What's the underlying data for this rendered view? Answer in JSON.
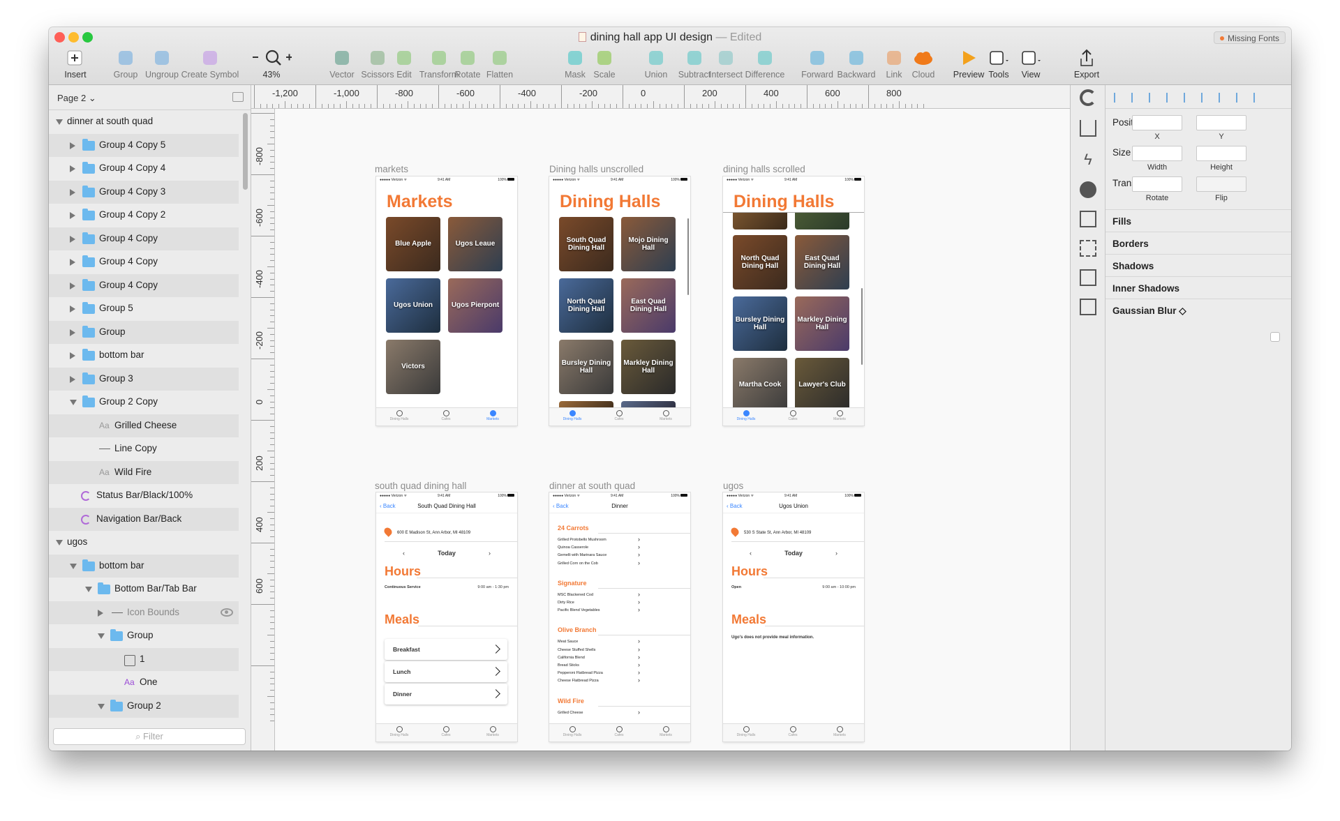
{
  "window": {
    "title": "dining hall app UI design",
    "edited": "— Edited",
    "missing_fonts": "Missing Fonts",
    "lights": [
      "#ff5f57",
      "#febc2e",
      "#28c840"
    ]
  },
  "toolbar": [
    {
      "id": "insert",
      "label": "Insert",
      "icon": "plus-icon"
    },
    {
      "id": "group",
      "label": "Group",
      "icon": "group-icon"
    },
    {
      "id": "ungroup",
      "label": "Ungroup",
      "icon": "ungroup-icon"
    },
    {
      "id": "create-symbol",
      "label": "Create Symbol",
      "icon": "symbol-icon"
    },
    {
      "id": "zoom",
      "label": "43%",
      "icon": "zoom-icon"
    },
    {
      "id": "vector",
      "label": "Vector",
      "icon": "pen-icon"
    },
    {
      "id": "scissors",
      "label": "Scissors",
      "icon": "scissors-icon"
    },
    {
      "id": "edit",
      "label": "Edit",
      "icon": "edit-icon"
    },
    {
      "id": "transform",
      "label": "Transform",
      "icon": "transform-icon"
    },
    {
      "id": "rotate",
      "label": "Rotate",
      "icon": "rotate-icon"
    },
    {
      "id": "flatten",
      "label": "Flatten",
      "icon": "flatten-icon"
    },
    {
      "id": "mask",
      "label": "Mask",
      "icon": "mask-icon"
    },
    {
      "id": "scale",
      "label": "Scale",
      "icon": "scale-icon"
    },
    {
      "id": "union",
      "label": "Union",
      "icon": "union-icon"
    },
    {
      "id": "subtract",
      "label": "Subtract",
      "icon": "subtract-icon"
    },
    {
      "id": "intersect",
      "label": "Intersect",
      "icon": "intersect-icon"
    },
    {
      "id": "difference",
      "label": "Difference",
      "icon": "difference-icon"
    },
    {
      "id": "forward",
      "label": "Forward",
      "icon": "forward-icon"
    },
    {
      "id": "backward",
      "label": "Backward",
      "icon": "backward-icon"
    },
    {
      "id": "link",
      "label": "Link",
      "icon": "link-icon"
    },
    {
      "id": "cloud",
      "label": "Cloud",
      "icon": "cloud-icon"
    },
    {
      "id": "preview",
      "label": "Preview",
      "icon": "play-icon"
    },
    {
      "id": "tools",
      "label": "Tools",
      "icon": "tools-icon"
    },
    {
      "id": "view",
      "label": "View",
      "icon": "view-icon"
    },
    {
      "id": "export",
      "label": "Export",
      "icon": "export-icon"
    }
  ],
  "layers": {
    "page": "Page 2",
    "filter_placeholder": "Filter",
    "rows": [
      {
        "name": "dinner at south quad",
        "kind": "page-group",
        "state": "open",
        "level": 0,
        "selected": false
      },
      {
        "name": "Group 4 Copy 5",
        "kind": "folder",
        "state": "closed",
        "level": 1,
        "selected": true
      },
      {
        "name": "Group 4 Copy 4",
        "kind": "folder",
        "state": "closed",
        "level": 1,
        "selected": false
      },
      {
        "name": "Group 4 Copy 3",
        "kind": "folder",
        "state": "closed",
        "level": 1,
        "selected": true
      },
      {
        "name": "Group 4 Copy 2",
        "kind": "folder",
        "state": "closed",
        "level": 1,
        "selected": false
      },
      {
        "name": "Group 4 Copy",
        "kind": "folder",
        "state": "closed",
        "level": 1,
        "selected": true
      },
      {
        "name": "Group 4 Copy",
        "kind": "folder",
        "state": "closed",
        "level": 1,
        "selected": false
      },
      {
        "name": "Group 4 Copy",
        "kind": "folder",
        "state": "closed",
        "level": 1,
        "selected": true
      },
      {
        "name": "Group 5",
        "kind": "folder",
        "state": "closed",
        "level": 1,
        "selected": false
      },
      {
        "name": "Group",
        "kind": "folder",
        "state": "closed",
        "level": 1,
        "selected": true
      },
      {
        "name": "bottom bar",
        "kind": "folder",
        "state": "closed",
        "level": 1,
        "selected": false
      },
      {
        "name": "Group 3",
        "kind": "folder",
        "state": "closed",
        "level": 1,
        "selected": true
      },
      {
        "name": "Group 2 Copy",
        "kind": "folder",
        "state": "open",
        "level": 1,
        "selected": false
      },
      {
        "name": "Grilled Cheese",
        "kind": "text",
        "state": "none",
        "level": 2,
        "selected": true
      },
      {
        "name": "Line Copy",
        "kind": "line",
        "state": "none",
        "level": 2,
        "selected": false
      },
      {
        "name": "Wild Fire",
        "kind": "text",
        "state": "none",
        "level": 2,
        "selected": true
      },
      {
        "name": "Status Bar/Black/100%",
        "kind": "symbol",
        "state": "none",
        "level": 1,
        "selected": false
      },
      {
        "name": "Navigation Bar/Back",
        "kind": "symbol",
        "state": "none",
        "level": 1,
        "selected": true
      },
      {
        "name": "ugos",
        "kind": "page-group",
        "state": "open",
        "level": 0,
        "selected": false
      },
      {
        "name": "bottom bar",
        "kind": "folder",
        "state": "open",
        "level": 1,
        "selected": true
      },
      {
        "name": "Bottom Bar/Tab Bar",
        "kind": "folder",
        "state": "open",
        "level": 2,
        "selected": false
      },
      {
        "name": "Icon Bounds",
        "kind": "line",
        "state": "closed",
        "level": 3,
        "selected": true,
        "hidden": true
      },
      {
        "name": "Group",
        "kind": "folder",
        "state": "open",
        "level": 3,
        "selected": false
      },
      {
        "name": "1",
        "kind": "box",
        "state": "none",
        "level": 4,
        "selected": true
      },
      {
        "name": "One",
        "kind": "text-purple",
        "state": "none",
        "level": 4,
        "selected": false
      },
      {
        "name": "Group 2",
        "kind": "folder",
        "state": "open",
        "level": 3,
        "selected": true
      }
    ]
  },
  "ruler": {
    "h": [
      "-1,200",
      "-1,000",
      "-800",
      "-600",
      "-400",
      "-200",
      "0",
      "200",
      "400",
      "600",
      "800"
    ],
    "v": [
      "-800",
      "-600",
      "-400",
      "-200",
      "0",
      "200",
      "400",
      "600"
    ]
  },
  "artboards": {
    "markets": {
      "label": "markets",
      "title": "Markets",
      "tiles": [
        "Blue Apple",
        "Ugos Leaue",
        "Ugos Union",
        "Ugos Pierpont",
        "Victors"
      ],
      "tab": 2
    },
    "unscrolled": {
      "label": "Dining halls unscrolled",
      "title": "Dining Halls",
      "tiles": [
        "South Quad Dining Hall",
        "Mojo Dining Hall",
        "North Quad Dining Hall",
        "East Quad Dining Hall",
        "Bursley Dining Hall",
        "Markley Dining Hall"
      ],
      "tab": 0
    },
    "scrolled": {
      "label": "dining halls scrolled",
      "title": "Dining Halls",
      "tiles": [
        "North Quad Dining Hall",
        "East Quad Dining Hall",
        "Bursley Dining Hall",
        "Markley Dining Hall",
        "Martha Cook",
        "Lawyer's Club"
      ],
      "tab": 0
    },
    "southquad": {
      "label": "south quad dining hall",
      "nav": "South Quad Dining Hall",
      "address": "600 E Madison St, Ann Arbor, MI 48109",
      "day": "Today",
      "hours": "Hours",
      "service": "Continuous Service",
      "time": "9:00 am - 1:30 pm",
      "meals_title": "Meals",
      "meals": [
        "Breakfast",
        "Lunch",
        "Dinner"
      ]
    },
    "dinner": {
      "label": "dinner at south quad",
      "nav": "Dinner",
      "sections": [
        {
          "title": "24 Carrots",
          "items": [
            "Grilled Protobello Mushroom",
            "Quinoa Casserole",
            "Gemelli with Marinara Sauce",
            "Grilled Corn on the Cob"
          ]
        },
        {
          "title": "Signature",
          "items": [
            "MSC Blackened Cod",
            "Dirty Rice",
            "Pacific Blend Vegetables"
          ]
        },
        {
          "title": "Olive Branch",
          "items": [
            "Meat Sauce",
            "Cheese Stuffed Shells",
            "California Blend",
            "Bread Sticks",
            "Pepperoni Flatbread Pizza",
            "Cheese Flatbread Pizza"
          ]
        },
        {
          "title": "Wild Fire",
          "items": [
            "Grilled Cheese"
          ]
        }
      ]
    },
    "ugos": {
      "label": "ugos",
      "nav": "Ugos Union",
      "address": "530 S State St, Ann Arbor, MI 48109",
      "day": "Today",
      "hours": "Hours",
      "service": "Open",
      "time": "9:00 am - 10:00 pm",
      "meals_title": "Meals",
      "note": "Ugo's does not provide meal information."
    }
  },
  "statusbar": {
    "carrier": "●●●●● Verizon ᯤ",
    "time": "9:41 AM",
    "battery": "100%"
  },
  "tabs": [
    "Dining Halls",
    "Cafes",
    "Markets"
  ],
  "back_label": "Back",
  "inspector": {
    "position": "Position",
    "size": "Size",
    "transform": "Transform",
    "x": "X",
    "y": "Y",
    "width": "Width",
    "height": "Height",
    "rotate": "Rotate",
    "flip": "Flip",
    "sections": [
      "Fills",
      "Borders",
      "Shadows",
      "Inner Shadows",
      "Gaussian Blur ◇"
    ]
  },
  "colors": {
    "accent": "#f27935",
    "link": "#3a86ff",
    "folder": "#6cb9ee"
  }
}
